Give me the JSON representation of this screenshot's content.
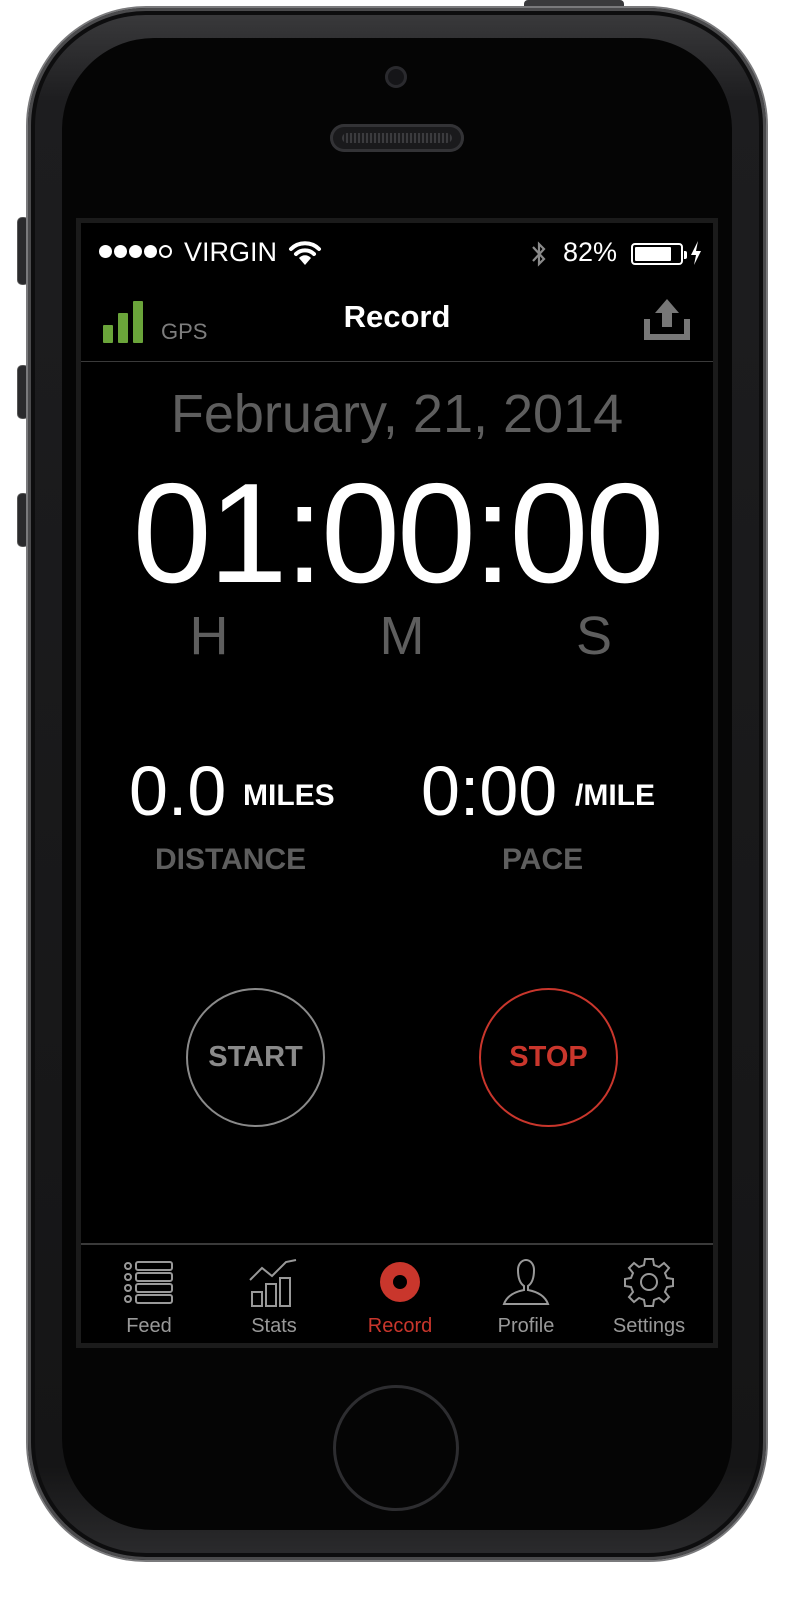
{
  "status": {
    "carrier": "VIRGIN",
    "battery_pct": "82%",
    "battery_level": 0.82,
    "signal_dots_filled": 4,
    "signal_dots_total": 5
  },
  "nav": {
    "gps_label": "GPS",
    "title": "Record"
  },
  "session": {
    "date": "February, 21, 2014",
    "timer": "01:00:00",
    "units": {
      "h": "H",
      "m": "M",
      "s": "S"
    }
  },
  "distance": {
    "value": "0.0",
    "unit": "MILES",
    "label": "DISTANCE"
  },
  "pace": {
    "value": "0:00",
    "unit": "/MILE",
    "label": "PACE"
  },
  "controls": {
    "start": "START",
    "stop": "STOP"
  },
  "tabs": [
    {
      "label": "Feed",
      "icon": "list-icon"
    },
    {
      "label": "Stats",
      "icon": "chart-icon"
    },
    {
      "label": "Record",
      "icon": "record-icon",
      "active": true
    },
    {
      "label": "Profile",
      "icon": "user-icon"
    },
    {
      "label": "Settings",
      "icon": "gear-icon"
    }
  ],
  "colors": {
    "accent": "#c9362c",
    "gps_green": "#6aa43a",
    "muted": "#5e5e5e"
  }
}
